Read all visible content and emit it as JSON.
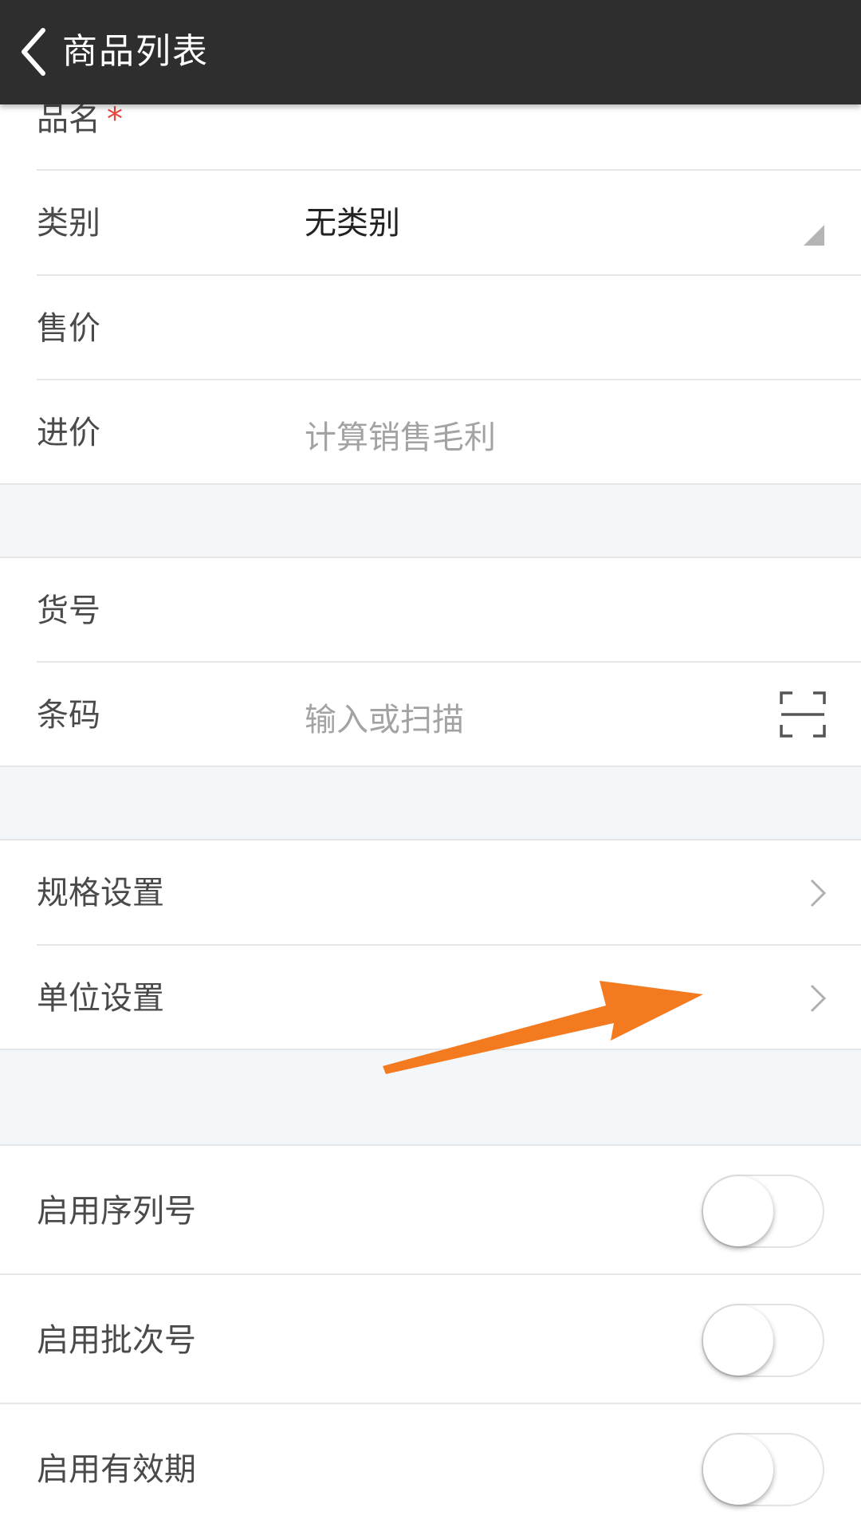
{
  "header": {
    "title": "商品列表"
  },
  "form": {
    "name_label": "品名",
    "required_mark": "*",
    "category_label": "类别",
    "category_value": "无类别",
    "sale_price_label": "售价",
    "cost_price_label": "进价",
    "cost_price_placeholder": "计算销售毛利",
    "item_no_label": "货号",
    "barcode_label": "条码",
    "barcode_placeholder": "输入或扫描",
    "spec_settings_label": "规格设置",
    "unit_settings_label": "单位设置",
    "serial_label": "启用序列号",
    "batch_label": "启用批次号",
    "expiry_label": "启用有效期"
  },
  "toggles": {
    "serial_on": false,
    "batch_on": false,
    "expiry_on": false
  },
  "colors": {
    "header_bg": "#2e2e2e",
    "required": "#e8453c",
    "annotation_arrow": "#f47a20",
    "section_gap": "#f4f7fa"
  },
  "icons": [
    "back-icon",
    "dropdown-corner-icon",
    "scan-icon",
    "chevron-right-icon",
    "annotation-arrow"
  ]
}
